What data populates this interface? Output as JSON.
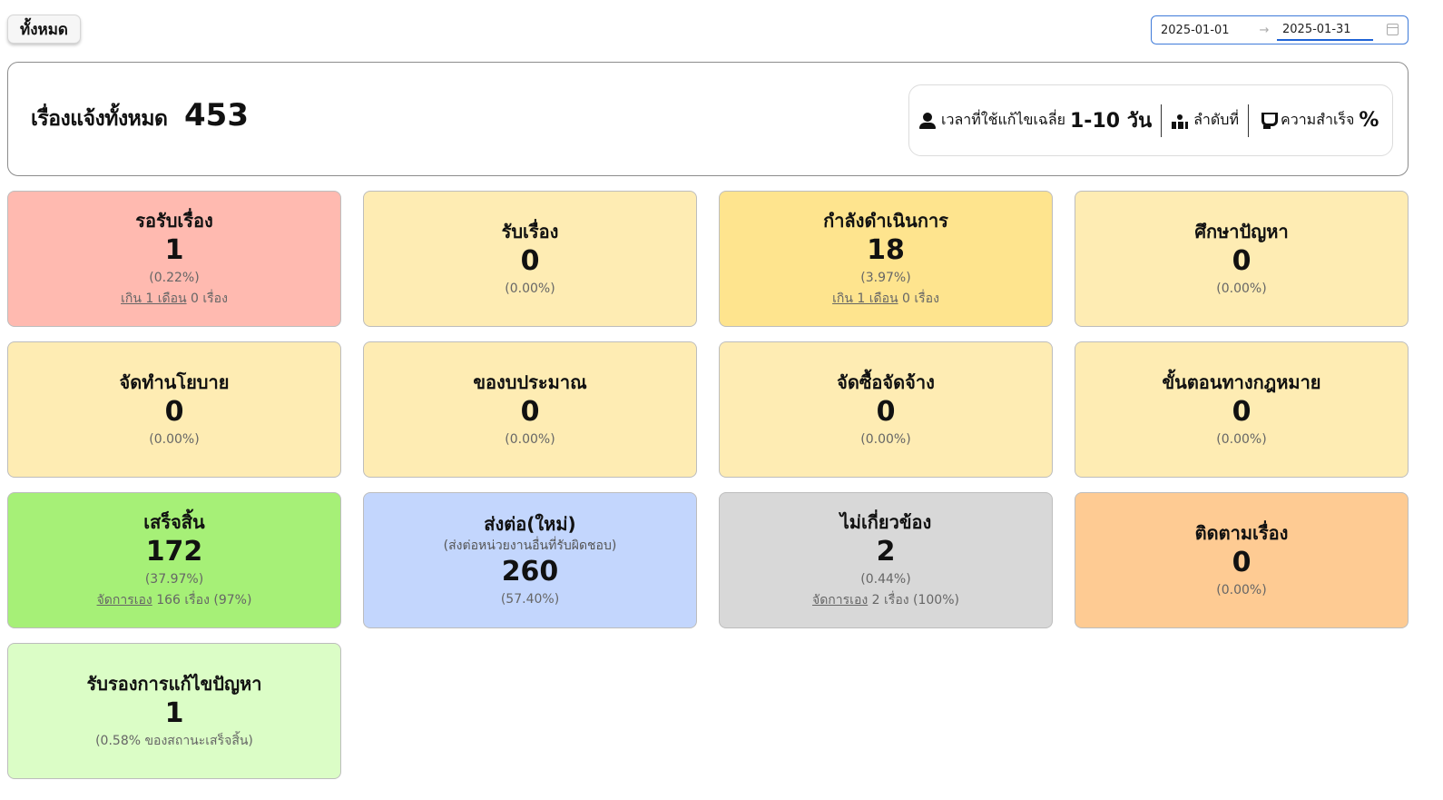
{
  "toolbar": {
    "all_label": "ทั้งหมด"
  },
  "date_range": {
    "start": "2025-01-01",
    "end": "2025-01-31",
    "separator": "→"
  },
  "summary": {
    "label": "เรื่องแจ้งทั้งหมด",
    "total": "453",
    "avg_time_label": "เวลาที่ใช้แก้ไขเฉลี่ย",
    "avg_time_value": "1-10 วัน",
    "rank_label": "ลำดับที่",
    "success_label": "ความสำเร็จ",
    "success_value": "%"
  },
  "cards": [
    {
      "title": "รอรับเรื่อง",
      "count": "1",
      "pct": "(0.22%)",
      "note_link": "เกิน 1 เดือน",
      "note_text": " 0 เรื่อง",
      "color": "#ffbab0"
    },
    {
      "title": "รับเรื่อง",
      "count": "0",
      "pct": "(0.00%)",
      "color": "#feecb3"
    },
    {
      "title": "กำลังดำเนินการ",
      "count": "18",
      "pct": "(3.97%)",
      "note_link": "เกิน 1 เดือน",
      "note_text": " 0 เรื่อง",
      "color": "#fee48e"
    },
    {
      "title": "ศึกษาปัญหา",
      "count": "0",
      "pct": "(0.00%)",
      "color": "#feecb3"
    },
    {
      "title": "จัดทำนโยบาย",
      "count": "0",
      "pct": "(0.00%)",
      "color": "#feecb3"
    },
    {
      "title": "ของบประมาณ",
      "count": "0",
      "pct": "(0.00%)",
      "color": "#feecb3"
    },
    {
      "title": "จัดซื้อจัดจ้าง",
      "count": "0",
      "pct": "(0.00%)",
      "color": "#feecb3"
    },
    {
      "title": "ขั้นตอนทางกฎหมาย",
      "count": "0",
      "pct": "(0.00%)",
      "color": "#feecb3"
    },
    {
      "title": "เสร็จสิ้น",
      "count": "172",
      "pct": "(37.97%)",
      "note_link": "จัดการเอง",
      "note_text": " 166 เรื่อง (97%)",
      "color": "#a6f077"
    },
    {
      "title": "ส่งต่อ(ใหม่)",
      "subtitle": "(ส่งต่อหน่วยงานอื่นที่รับผิดชอบ)",
      "count": "260",
      "pct": "(57.40%)",
      "color": "#c3d6fd"
    },
    {
      "title": "ไม่เกี่ยวข้อง",
      "count": "2",
      "pct": "(0.44%)",
      "note_link": "จัดการเอง",
      "note_text": " 2 เรื่อง (100%)",
      "color": "#d8d8d8"
    },
    {
      "title": "ติดตามเรื่อง",
      "count": "0",
      "pct": "(0.00%)",
      "color": "#fecb93"
    },
    {
      "title": "รับรองการแก้ไขปัญหา",
      "count": "1",
      "pct": "(0.58% ของสถานะเสร็จสิ้น)",
      "color": "#dbfdc6"
    }
  ]
}
